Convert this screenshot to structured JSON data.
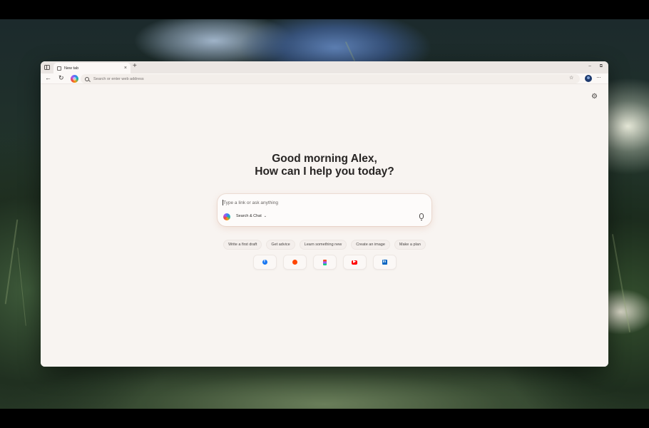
{
  "tab": {
    "title": "New tab",
    "close_glyph": "×",
    "new_tab_glyph": "+"
  },
  "window_controls": {
    "minimize": "–",
    "restore": "⧉"
  },
  "toolbar": {
    "back_glyph": "←",
    "refresh_glyph": "↻",
    "address_placeholder": "Search or enter web address",
    "favorites_glyph": "☆",
    "more_glyph": "···"
  },
  "newtab": {
    "greeting_line1": "Good morning Alex,",
    "greeting_line2": "How can I help you today?",
    "ask_placeholder": "Type a link or ask anything",
    "mode_label": "Search & Chat",
    "mode_chevron": "⌄",
    "settings_glyph": "⚙",
    "chips": [
      "Write a first draft",
      "Get advice",
      "Learn something new",
      "Create an image",
      "Make a plan"
    ],
    "tiles": [
      {
        "icon": "facebook-icon",
        "glyph": "f",
        "color": "#1877f2"
      },
      {
        "icon": "reddit-icon",
        "glyph": "",
        "color": "#ff4500"
      },
      {
        "icon": "figma-icon",
        "glyph": "",
        "color": "#a259ff"
      },
      {
        "icon": "youtube-icon",
        "glyph": "▶",
        "color": "#ff0000"
      },
      {
        "icon": "linkedin-icon",
        "glyph": "in",
        "color": "#0a66c2"
      }
    ]
  }
}
